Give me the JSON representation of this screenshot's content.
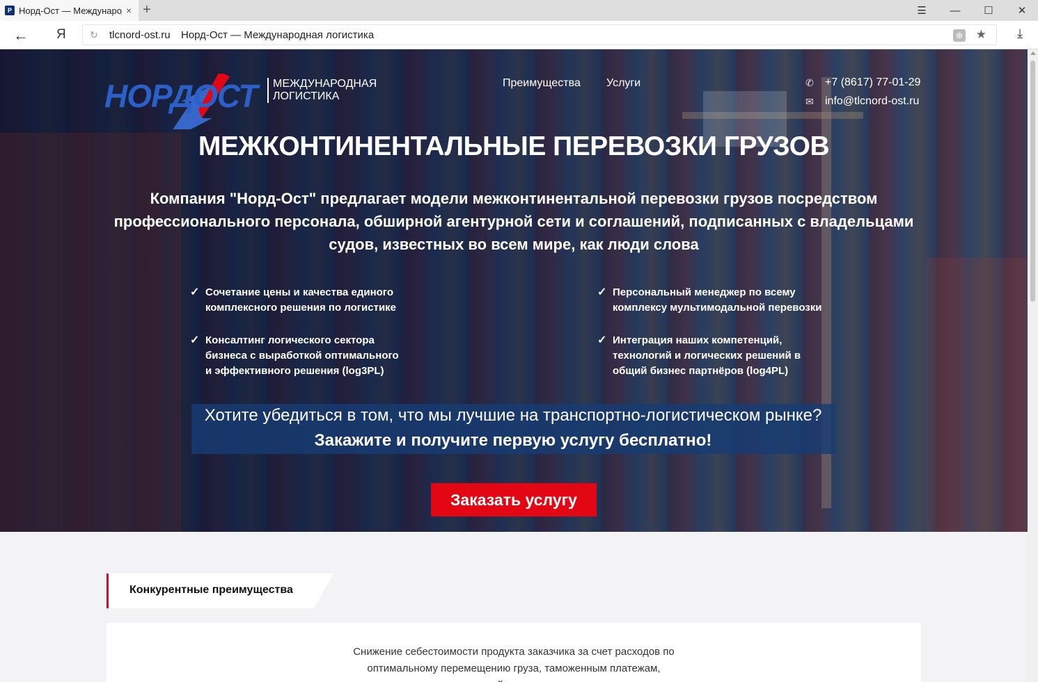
{
  "browser": {
    "tab_title": "Норд-Ост — Международная логистика",
    "tab_favicon": "P",
    "url_host": "tlcnord-ost.ru",
    "url_title": "Норд-Ост — Международная логистика",
    "yandex_label": "Я",
    "icons": {
      "back": "←",
      "reload": "↻",
      "close_tab": "×",
      "new_tab": "+",
      "menu": "☰",
      "minimize": "—",
      "maximize": "☐",
      "close_window": "✕",
      "translate": "⊕",
      "bookmark": "★",
      "download": "⤓"
    }
  },
  "site": {
    "logo": {
      "word": "НОРДОСТ",
      "sub_line1": "Международная",
      "sub_line2": "логистика"
    },
    "nav": [
      {
        "label": "Преимущества"
      },
      {
        "label": "Услуги"
      }
    ],
    "contacts": {
      "phone": "+7 (8617) 77-01-29",
      "email": "info@tlcnord-ost.ru",
      "phone_icon": "✆",
      "email_icon": "✉"
    },
    "hero": {
      "title": "Межконтинентальные перевозки грузов",
      "lead": "Компания \"Норд-Ост\" предлагает модели межконтинентальной перевозки грузов посредством профессионального персонала, обширной агентурной сети и соглашений, подписанных с владельцами судов, известных во всем мире, как люди слова",
      "check_icon": "✓",
      "features": [
        "Сочетание цены и качества единого комплексного решения по логистике",
        "Персональный менеджер по всему комплексу мультимодальной перевозки",
        "Консалтинг логического сектора бизнеса с выработкой оптимального и эффективного решения (log3PL)",
        "Интеграция наших компетенций, технологий и логических решений в общий бизнес партнёров (log4PL)"
      ],
      "cta_line1": "Хотите убедиться в том, что мы лучшие на транспортно-логистическом рынке?",
      "cta_line2": "Закажите и получите первую услугу бесплатно!",
      "order_button": "Заказать услугу"
    },
    "advantages": {
      "tab_label": "Конкурентные преимущества",
      "first_item": "Снижение себестоимости продукта заказчика за счет расходов по оптимальному перемещению груза, таможенным платежам, «умной» логистики"
    },
    "colors": {
      "brand_blue": "#2b60c8",
      "accent_red": "#e30613",
      "cta_blue": "#173c73"
    }
  }
}
